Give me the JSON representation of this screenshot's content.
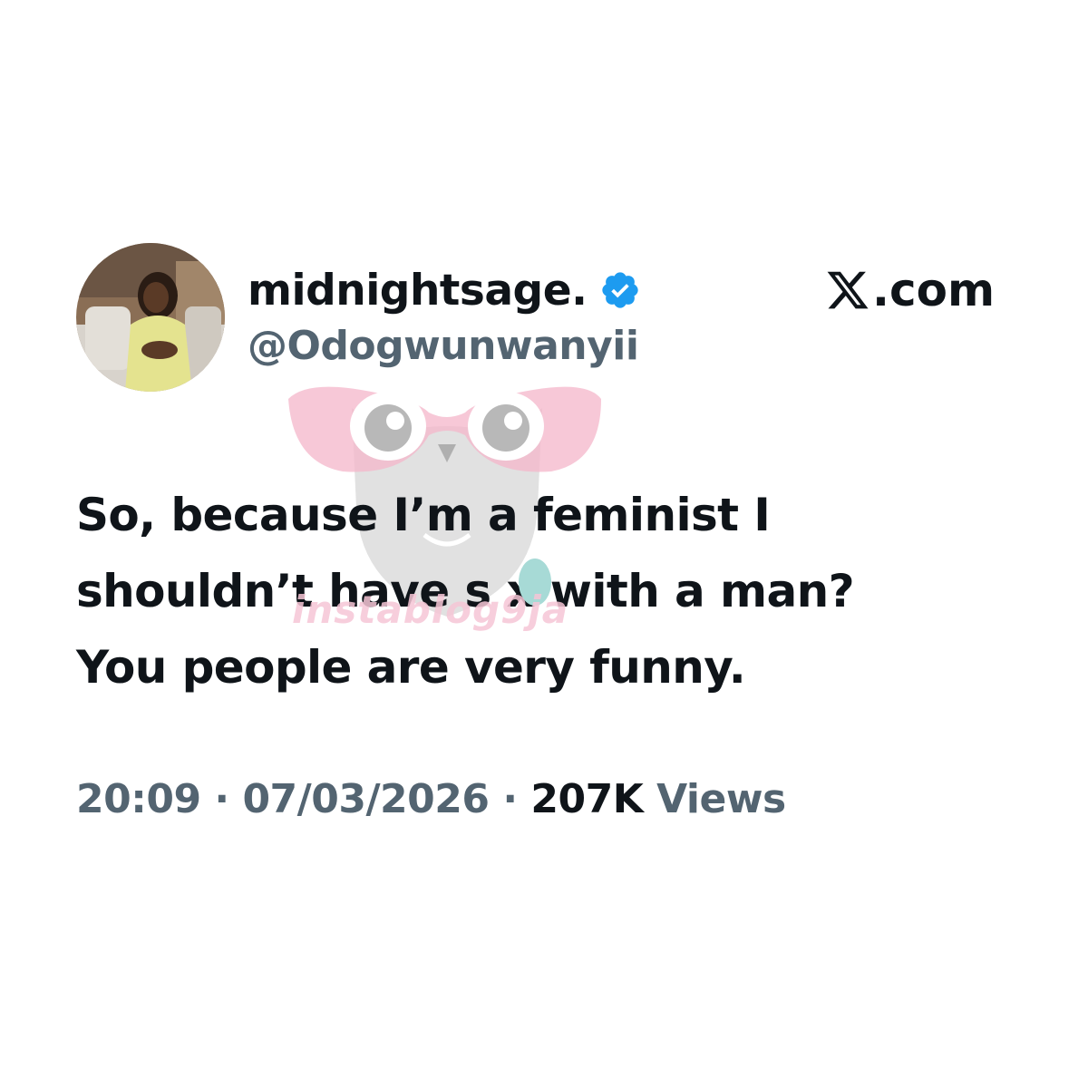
{
  "author": {
    "display_name": "midnightsage.",
    "handle": "@Odogwunwanyii",
    "verified": true,
    "avatar_icon": "profile-photo"
  },
  "site": {
    "label": ".com",
    "logo_icon": "x-logo-icon"
  },
  "tweet": {
    "lines": [
      "So, because I’m a feminist I",
      "shouldn’t have s x with a man?",
      "You people are very funny."
    ]
  },
  "meta": {
    "time": "20:09",
    "separator": "·",
    "date": "07/03/2026",
    "views_count": "207K",
    "views_label": "Views"
  },
  "watermark": {
    "text": "instablog9ja",
    "icon": "owl-glasses-logo-icon"
  },
  "colors": {
    "text_primary": "#0f1419",
    "text_secondary": "#536471",
    "verified_blue": "#1d9bf0",
    "watermark_pink": "#f4b6c9",
    "censor_teal": "#a7dad6"
  }
}
